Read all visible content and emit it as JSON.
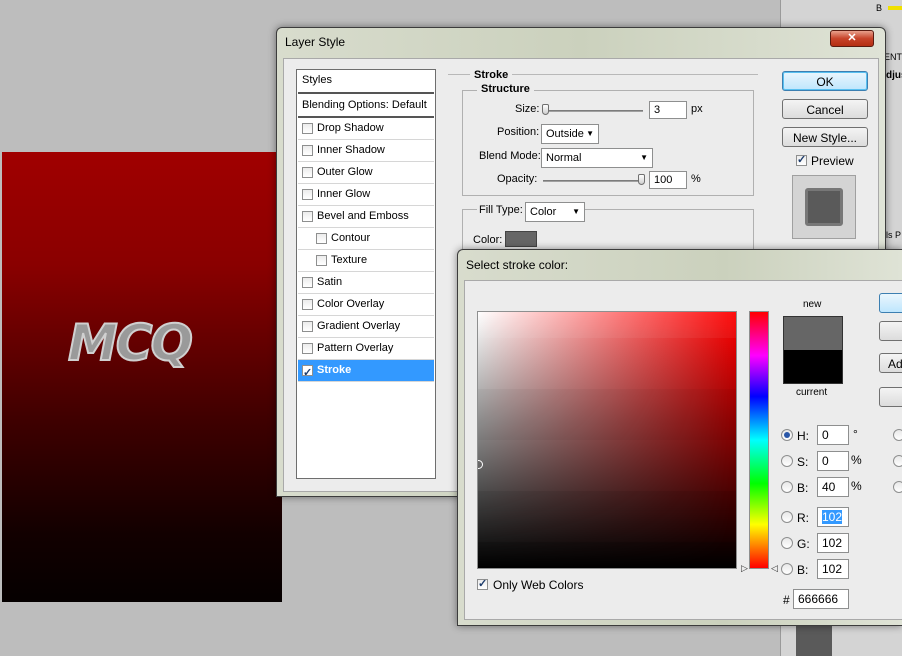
{
  "colors": {
    "accent": "#3399ff",
    "canvas_red": "#a00000",
    "selected_color": "#666666"
  },
  "canvas": {
    "logo_text": "MCQ"
  },
  "right_panel": {
    "b_label": "B",
    "ent_label": "ENT",
    "djus_label": "djus",
    "lsp_label": "ls P"
  },
  "layer_style": {
    "title": "Layer Style",
    "styles_header": "Styles",
    "blending_options": "Blending Options: Default",
    "items": [
      {
        "label": "Drop Shadow",
        "checked": false,
        "indent": 0
      },
      {
        "label": "Inner Shadow",
        "checked": false,
        "indent": 0
      },
      {
        "label": "Outer Glow",
        "checked": false,
        "indent": 0
      },
      {
        "label": "Inner Glow",
        "checked": false,
        "indent": 0
      },
      {
        "label": "Bevel and Emboss",
        "checked": false,
        "indent": 0
      },
      {
        "label": "Contour",
        "checked": false,
        "indent": 1
      },
      {
        "label": "Texture",
        "checked": false,
        "indent": 1
      },
      {
        "label": "Satin",
        "checked": false,
        "indent": 0
      },
      {
        "label": "Color Overlay",
        "checked": false,
        "indent": 0
      },
      {
        "label": "Gradient Overlay",
        "checked": false,
        "indent": 0
      },
      {
        "label": "Pattern Overlay",
        "checked": false,
        "indent": 0
      },
      {
        "label": "Stroke",
        "checked": true,
        "indent": 0,
        "selected": true
      }
    ],
    "stroke": {
      "section_title": "Stroke",
      "structure_title": "Structure",
      "size_label": "Size:",
      "size_value": "3",
      "size_unit": "px",
      "position_label": "Position:",
      "position_value": "Outside",
      "blend_mode_label": "Blend Mode:",
      "blend_mode_value": "Normal",
      "opacity_label": "Opacity:",
      "opacity_value": "100",
      "opacity_unit": "%",
      "fill_type_label": "Fill Type:",
      "fill_type_value": "Color",
      "color_label": "Color:"
    },
    "buttons": {
      "ok": "OK",
      "cancel": "Cancel",
      "new_style": "New Style...",
      "preview": "Preview"
    }
  },
  "color_picker": {
    "title": "Select stroke color:",
    "new_label": "new",
    "current_label": "current",
    "new_color": "#666666",
    "current_color": "#000000",
    "only_web_colors": "Only Web Colors",
    "add_label": "Ad",
    "fields": {
      "h_label": "H:",
      "h_value": "0",
      "h_unit": "°",
      "s_label": "S:",
      "s_value": "0",
      "s_unit": "%",
      "b_label": "B:",
      "b_value": "40",
      "b_unit": "%",
      "r_label": "R:",
      "r_value": "102",
      "g_label": "G:",
      "g_value": "102",
      "b2_label": "B:",
      "b2_value": "102",
      "hex_label": "#",
      "hex_value": "666666"
    }
  }
}
